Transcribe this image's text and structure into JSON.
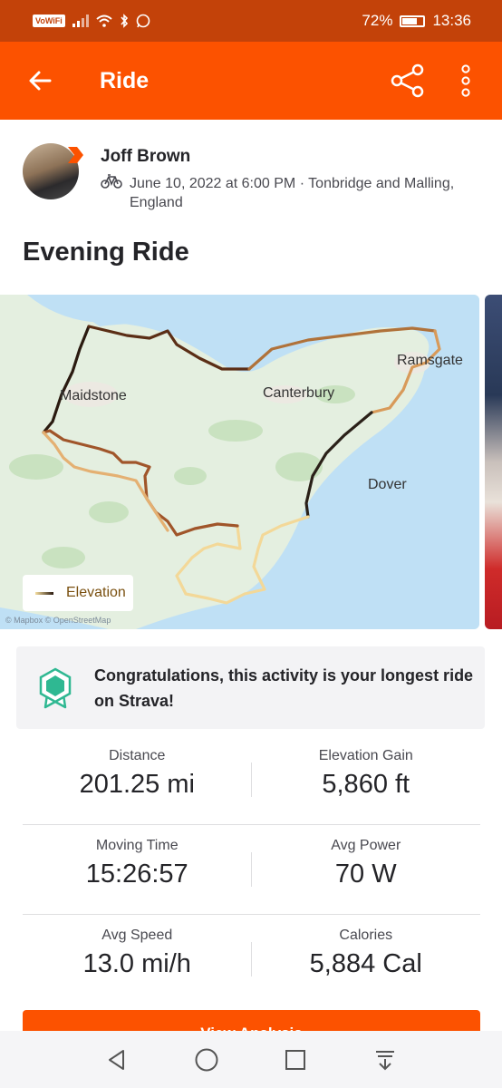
{
  "status_bar": {
    "vowifi": "VoWiFi",
    "battery": "72%",
    "battery_level": 0.72,
    "time": "13:36"
  },
  "app_bar": {
    "title": "Ride",
    "icons": [
      "back-arrow-icon",
      "share-icon",
      "more-vertical-icon"
    ]
  },
  "athlete": {
    "name": "Joff Brown",
    "activity_type_icon": "bicycle-icon",
    "meta": "June 10, 2022 at 6:00 PM · Tonbridge and Malling, England"
  },
  "activity": {
    "title": "Evening Ride"
  },
  "map": {
    "places": {
      "maidstone": "Maidstone",
      "canterbury": "Canterbury",
      "ramsgate": "Ramsgate",
      "dover": "Dover"
    },
    "legend": "Elevation",
    "attribution": "© Mapbox © OpenStreetMap",
    "colors": {
      "sea": "#bfe0f5",
      "land": "#e4efe0",
      "route_low": "#f6dfa0",
      "route_high": "#2a1a10"
    }
  },
  "achievement": {
    "icon": "achievement-badge-icon",
    "text": "Congratulations, this activity is your longest ride on Strava!"
  },
  "stats": [
    {
      "label": "Distance",
      "value": "201.25 mi"
    },
    {
      "label": "Elevation Gain",
      "value": "5,860 ft"
    },
    {
      "label": "Moving Time",
      "value": "15:26:57"
    },
    {
      "label": "Avg Power",
      "value": "70 W"
    },
    {
      "label": "Avg Speed",
      "value": "13.0 mi/h"
    },
    {
      "label": "Calories",
      "value": "5,884 Cal"
    }
  ],
  "cta": {
    "label": "View Analysis"
  },
  "nav": {
    "icons": [
      "back-triangle-icon",
      "home-circle-icon",
      "recents-square-icon",
      "notification-pull-icon"
    ]
  },
  "colors": {
    "brand": "#fc5200",
    "status_bar": "#c34209"
  }
}
